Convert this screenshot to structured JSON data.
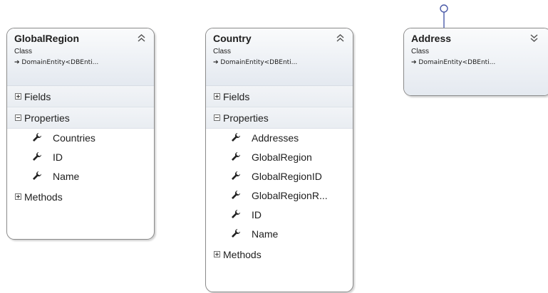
{
  "classes": [
    {
      "name": "GlobalRegion",
      "kind": "Class",
      "base": "DomainEntity<DBEnti...",
      "expanded": true,
      "fields_label": "Fields",
      "properties_label": "Properties",
      "properties": [
        "Countries",
        "ID",
        "Name"
      ],
      "methods_label": "Methods"
    },
    {
      "name": "Country",
      "kind": "Class",
      "base": "DomainEntity<DBEnti...",
      "expanded": true,
      "fields_label": "Fields",
      "properties_label": "Properties",
      "properties": [
        "Addresses",
        "GlobalRegion",
        "GlobalRegionID",
        "GlobalRegionR...",
        "ID",
        "Name"
      ],
      "methods_label": "Methods"
    },
    {
      "name": "Address",
      "kind": "Class",
      "base": "DomainEntity<DBEnti...",
      "expanded": false
    }
  ],
  "icons": {
    "collapse": "double-chevron-up-icon",
    "expand": "double-chevron-down-icon",
    "property": "wrench-icon",
    "inheritance": "arrow-right-icon",
    "interface": "lollipop-icon"
  },
  "colors": {
    "border": "#8a8a8a",
    "header_top": "#fafbfc",
    "header_bottom": "#e4e9f0",
    "compartment": "#eef1f5",
    "text": "#1e1e1e",
    "lollipop": "#4a5aa8"
  }
}
